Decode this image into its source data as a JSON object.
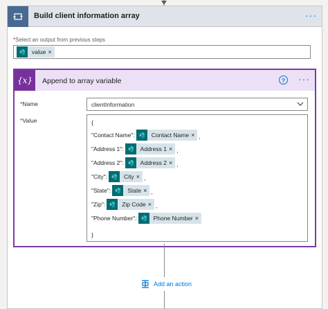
{
  "outer": {
    "title": "Build client information array",
    "more": "···",
    "select_required": "*",
    "select_label": "Select an output from previous steps",
    "token": {
      "label": "value",
      "close": "×",
      "icon": "sharepoint-icon"
    }
  },
  "inner": {
    "icon_text": "{x}",
    "title": "Append to array variable",
    "help": "?",
    "more": "···",
    "name_required": "*",
    "name_label": "Name",
    "name_value": "clientInformation",
    "value_required": "*",
    "value_label": "Value",
    "json": {
      "open": "{",
      "close": "}",
      "rows": [
        {
          "key": "\"Contact Name\":",
          "token": "Contact Name",
          "suffix": ","
        },
        {
          "key": "\"Address 1\":",
          "token": "Address 1",
          "suffix": ","
        },
        {
          "key": "\"Address 2\":",
          "token": "Address 2",
          "suffix": ","
        },
        {
          "key": "\"City\":",
          "token": "City",
          "suffix": ","
        },
        {
          "key": "\"State\":",
          "token": "State",
          "suffix": ","
        },
        {
          "key": "\"Zip\":",
          "token": "Zip Code",
          "suffix": ","
        },
        {
          "key": "\"Phone Number\":",
          "token": "Phone Number",
          "suffix": ""
        }
      ],
      "token_close": "×"
    }
  },
  "add_action": {
    "label": "Add an action",
    "icon": "add-action-icon"
  },
  "colors": {
    "accent": "#0078d4",
    "variable_purple": "#77319d",
    "loop_blue": "#486991",
    "sharepoint_teal": "#036c70",
    "token_bg": "#d6e4ea"
  }
}
